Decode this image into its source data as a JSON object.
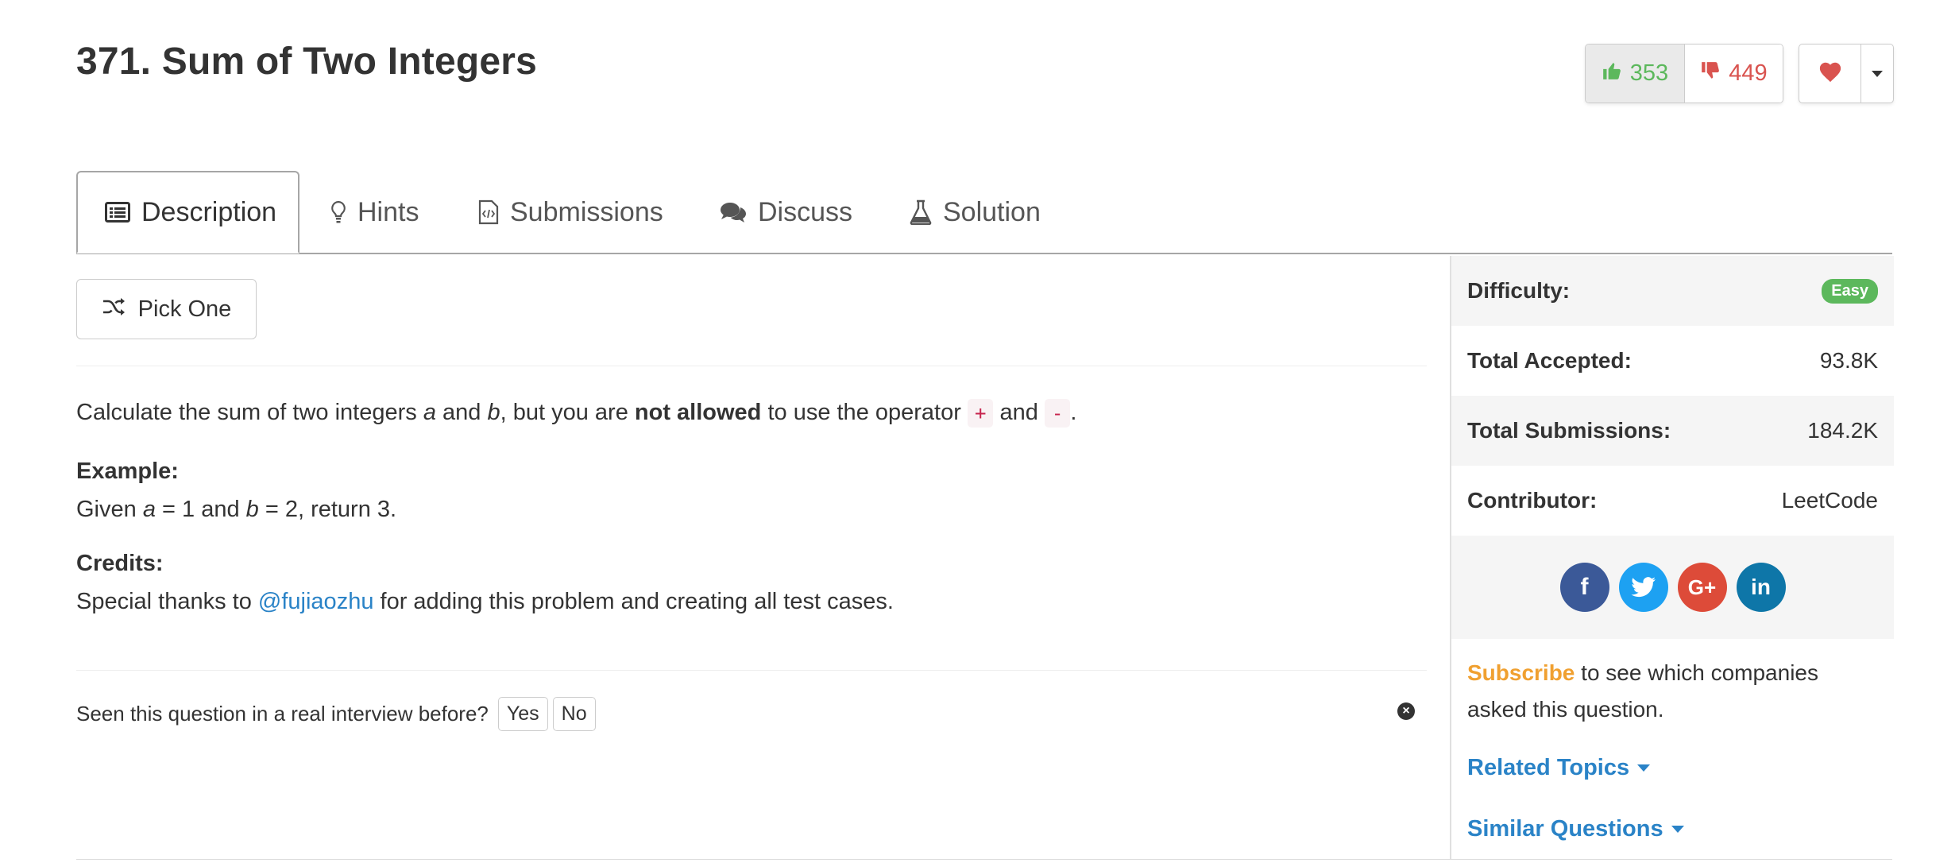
{
  "problem": {
    "title": "371. Sum of Two Integers"
  },
  "votes": {
    "up": "353",
    "down": "449"
  },
  "tabs": [
    {
      "label": "Description",
      "icon": "list-icon"
    },
    {
      "label": "Hints",
      "icon": "lightbulb-icon"
    },
    {
      "label": "Submissions",
      "icon": "code-file-icon"
    },
    {
      "label": "Discuss",
      "icon": "comments-icon"
    },
    {
      "label": "Solution",
      "icon": "flask-icon"
    }
  ],
  "pick_one": {
    "label": "Pick One",
    "icon": "shuffle-icon"
  },
  "description": {
    "part1": "Calculate the sum of two integers ",
    "var_a": "a",
    "part2": " and ",
    "var_b": "b",
    "part3": ", but you are ",
    "bold": "not allowed",
    "part4": " to use the operator ",
    "op_plus": "+",
    "part5": " and ",
    "op_minus": "-",
    "part6": "."
  },
  "example": {
    "heading": "Example:",
    "given": "Given ",
    "var_a": "a",
    "eq1": " = 1 and ",
    "var_b": "b",
    "eq2": " = 2, return 3."
  },
  "credits": {
    "heading": "Credits:",
    "prefix": "Special thanks to ",
    "user": "@fujiaozhu",
    "suffix": " for adding this problem and creating all test cases."
  },
  "interview": {
    "question": "Seen this question in a real interview before?",
    "yes": "Yes",
    "no": "No"
  },
  "sidebar": {
    "difficulty_label": "Difficulty:",
    "difficulty_value": "Easy",
    "accepted_label": "Total Accepted:",
    "accepted_value": "93.8K",
    "submissions_label": "Total Submissions:",
    "submissions_value": "184.2K",
    "contributor_label": "Contributor:",
    "contributor_value": "LeetCode",
    "social": [
      {
        "name": "facebook",
        "glyph": "f"
      },
      {
        "name": "twitter",
        "glyph": ""
      },
      {
        "name": "google-plus",
        "glyph": "G+"
      },
      {
        "name": "linkedin",
        "glyph": "in"
      }
    ],
    "subscribe_link": "Subscribe",
    "subscribe_text": " to see which companies asked this question.",
    "related_topics": "Related Topics",
    "similar_questions": "Similar Questions"
  },
  "colors": {
    "up_vote": "#5cb85c",
    "down_vote": "#d9534f",
    "heart": "#d9534f",
    "link": "#2a83c7",
    "subscribe": "#f0a030",
    "easy_badge": "#5cb85c"
  }
}
